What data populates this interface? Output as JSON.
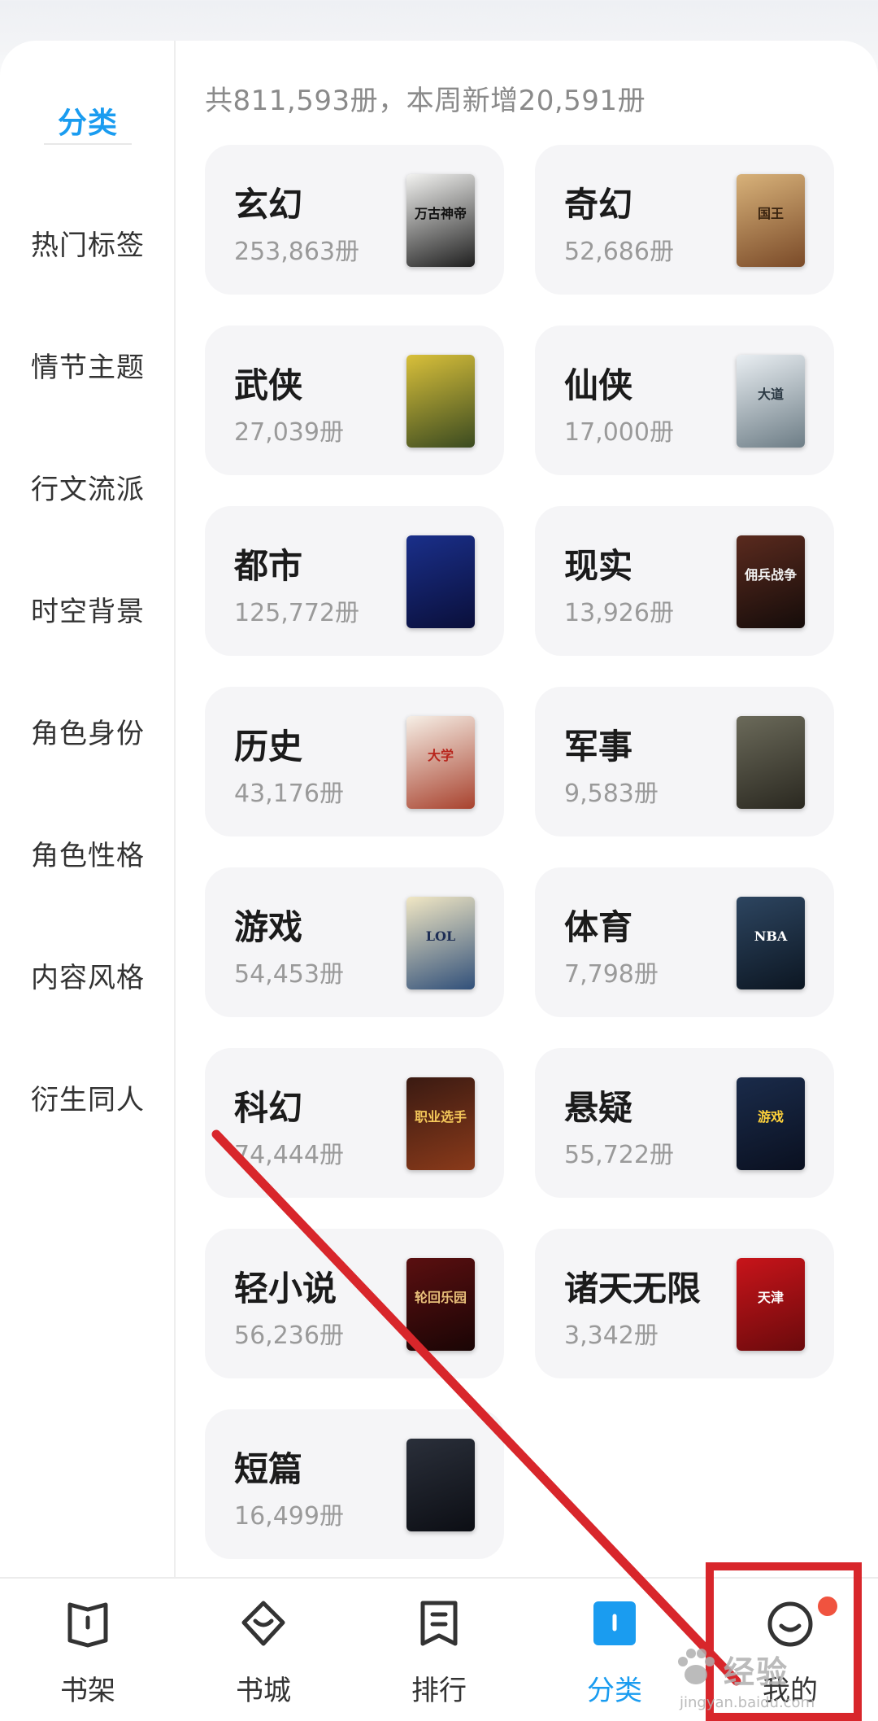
{
  "sidebar": {
    "items": [
      {
        "label": "分类",
        "active": true
      },
      {
        "label": "热门标签"
      },
      {
        "label": "情节主题"
      },
      {
        "label": "行文流派"
      },
      {
        "label": "时空背景"
      },
      {
        "label": "角色身份"
      },
      {
        "label": "角色性格"
      },
      {
        "label": "内容风格"
      },
      {
        "label": "衍生同人"
      }
    ]
  },
  "summary": "共811,593册，本周新增20,591册",
  "categories": [
    {
      "name": "玄幻",
      "count": "253,863册",
      "cover_text": "万古神帝",
      "cover_colors": [
        "#f2f2f0",
        "#1f1f1f"
      ],
      "cover_ink": "#111111"
    },
    {
      "name": "奇幻",
      "count": "52,686册",
      "cover_text": "国王",
      "cover_colors": [
        "#d8b27a",
        "#7a4a28"
      ],
      "cover_ink": "#3a2410"
    },
    {
      "name": "武侠",
      "count": "27,039册",
      "cover_text": "",
      "cover_colors": [
        "#d9c03a",
        "#3a4a20"
      ],
      "cover_ink": "#ffffff"
    },
    {
      "name": "仙侠",
      "count": "17,000册",
      "cover_text": "大道",
      "cover_colors": [
        "#e9eef2",
        "#6d7d86"
      ],
      "cover_ink": "#2b3944"
    },
    {
      "name": "都市",
      "count": "125,772册",
      "cover_text": "",
      "cover_colors": [
        "#1a2f8a",
        "#0a0f3a"
      ],
      "cover_ink": "#9fc2ff"
    },
    {
      "name": "现实",
      "count": "13,926册",
      "cover_text": "佣兵战争",
      "cover_colors": [
        "#5a2a1e",
        "#150c0a"
      ],
      "cover_ink": "#f2f2f2"
    },
    {
      "name": "历史",
      "count": "43,176册",
      "cover_text": "大学",
      "cover_colors": [
        "#f6efe6",
        "#a8422e"
      ],
      "cover_ink": "#b8251c"
    },
    {
      "name": "军事",
      "count": "9,583册",
      "cover_text": "",
      "cover_colors": [
        "#6b6a5a",
        "#2a2820"
      ],
      "cover_ink": "#e8d26a"
    },
    {
      "name": "游戏",
      "count": "54,453册",
      "cover_text": "LOL",
      "cover_colors": [
        "#f1e7c4",
        "#31507a"
      ],
      "cover_ink": "#1e2e55"
    },
    {
      "name": "体育",
      "count": "7,798册",
      "cover_text": "NBA",
      "cover_colors": [
        "#2d4560",
        "#0c1622"
      ],
      "cover_ink": "#ffffff"
    },
    {
      "name": "科幻",
      "count": "74,444册",
      "cover_text": "职业选手",
      "cover_colors": [
        "#3a1a12",
        "#8a3a1a"
      ],
      "cover_ink": "#f4c75a"
    },
    {
      "name": "悬疑",
      "count": "55,722册",
      "cover_text": "游戏",
      "cover_colors": [
        "#1a2b4a",
        "#0a1020"
      ],
      "cover_ink": "#ffd23a"
    },
    {
      "name": "轻小说",
      "count": "56,236册",
      "cover_text": "轮回乐园",
      "cover_colors": [
        "#5a0f10",
        "#1a0505"
      ],
      "cover_ink": "#e8c07a"
    },
    {
      "name": "诸天无限",
      "count": "3,342册",
      "cover_text": "天津",
      "cover_colors": [
        "#c8141a",
        "#6a0a0c"
      ],
      "cover_ink": "#ffffff"
    },
    {
      "name": "短篇",
      "count": "16,499册",
      "cover_text": "",
      "cover_colors": [
        "#2a2f3a",
        "#0c0e14"
      ],
      "cover_ink": "#d0a0a0"
    }
  ],
  "tabbar": {
    "tabs": [
      {
        "label": "书架",
        "icon": "bookshelf-icon"
      },
      {
        "label": "书城",
        "icon": "bookstore-icon"
      },
      {
        "label": "排行",
        "icon": "ranking-icon"
      },
      {
        "label": "分类",
        "icon": "category-icon",
        "active": true
      },
      {
        "label": "我的",
        "icon": "profile-icon",
        "badge": true
      }
    ]
  },
  "watermark": {
    "main": "经验",
    "sub": "jingyan.baidu.com"
  },
  "colors": {
    "accent": "#1a9cf0",
    "annotation": "#d8262b",
    "badge": "#f0533f"
  }
}
